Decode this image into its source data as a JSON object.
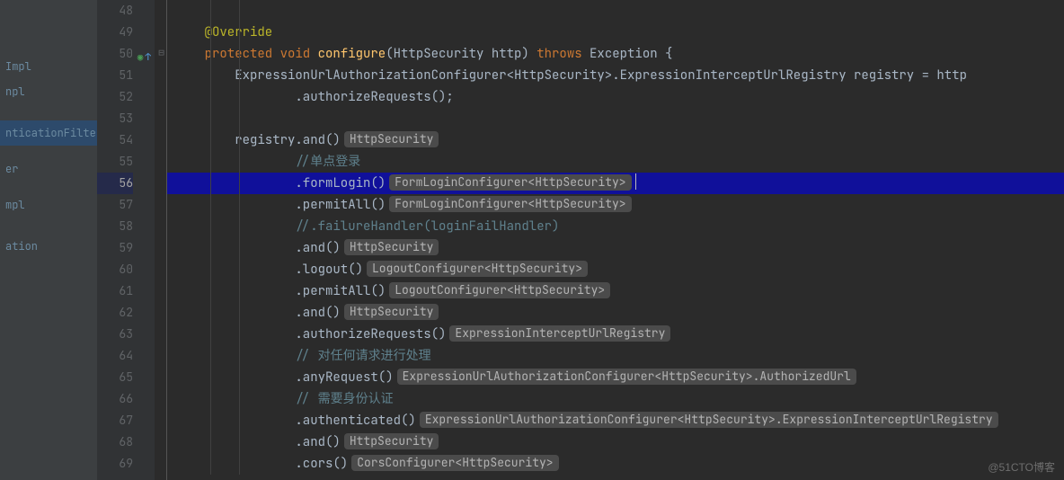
{
  "sidebar": {
    "items": [
      {
        "label": "Impl"
      },
      {
        "label": "npl"
      },
      {
        "label": ""
      },
      {
        "label": ""
      },
      {
        "label": ""
      },
      {
        "label": "nticationFilter"
      },
      {
        "label": ""
      },
      {
        "label": ""
      },
      {
        "label": "er"
      },
      {
        "label": ""
      },
      {
        "label": ""
      },
      {
        "label": "mpl"
      },
      {
        "label": ""
      },
      {
        "label": ""
      },
      {
        "label": ""
      },
      {
        "label": "ation"
      }
    ]
  },
  "gutter": {
    "start": 48,
    "end": 69,
    "highlight": 56,
    "override_line": 50
  },
  "code": {
    "lines": [
      {
        "n": 48,
        "segs": []
      },
      {
        "n": 49,
        "segs": [
          {
            "t": "    ",
            "c": ""
          },
          {
            "t": "@Override",
            "c": "kw-ann"
          }
        ]
      },
      {
        "n": 50,
        "segs": [
          {
            "t": "    ",
            "c": ""
          },
          {
            "t": "protected void ",
            "c": "kw"
          },
          {
            "t": "configure",
            "c": "fn"
          },
          {
            "t": "(HttpSecurity http) ",
            "c": ""
          },
          {
            "t": "throws ",
            "c": "kw"
          },
          {
            "t": "Exception {",
            "c": ""
          }
        ]
      },
      {
        "n": 51,
        "segs": [
          {
            "t": "        ExpressionUrlAuthorizationConfigurer<HttpSecurity>.ExpressionInterceptUrlRegistry registry = http",
            "c": ""
          }
        ]
      },
      {
        "n": 52,
        "segs": [
          {
            "t": "                .authorizeRequests();",
            "c": ""
          }
        ]
      },
      {
        "n": 53,
        "segs": []
      },
      {
        "n": 54,
        "segs": [
          {
            "t": "        registry.and()",
            "c": ""
          },
          {
            "hint": "HttpSecurity"
          }
        ]
      },
      {
        "n": 55,
        "segs": [
          {
            "t": "                ",
            "c": ""
          },
          {
            "t": "//单点登录",
            "c": "cmt-cn"
          }
        ]
      },
      {
        "n": 56,
        "hl": true,
        "segs": [
          {
            "t": "                .formLogin()",
            "c": ""
          },
          {
            "hint": "FormLoginConfigurer<HttpSecurity>"
          },
          {
            "caret": true
          }
        ]
      },
      {
        "n": 57,
        "segs": [
          {
            "t": "                .permitAll()",
            "c": ""
          },
          {
            "hint": "FormLoginConfigurer<HttpSecurity>"
          }
        ]
      },
      {
        "n": 58,
        "segs": [
          {
            "t": "                ",
            "c": ""
          },
          {
            "t": "//.failureHandler(loginFailHandler)",
            "c": "cmt-cn"
          }
        ]
      },
      {
        "n": 59,
        "segs": [
          {
            "t": "                .and()",
            "c": ""
          },
          {
            "hint": "HttpSecurity"
          }
        ]
      },
      {
        "n": 60,
        "segs": [
          {
            "t": "                .logout()",
            "c": ""
          },
          {
            "hint": "LogoutConfigurer<HttpSecurity>"
          }
        ]
      },
      {
        "n": 61,
        "segs": [
          {
            "t": "                .permitAll()",
            "c": ""
          },
          {
            "hint": "LogoutConfigurer<HttpSecurity>"
          }
        ]
      },
      {
        "n": 62,
        "segs": [
          {
            "t": "                .and()",
            "c": ""
          },
          {
            "hint": "HttpSecurity"
          }
        ]
      },
      {
        "n": 63,
        "segs": [
          {
            "t": "                .authorizeRequests()",
            "c": ""
          },
          {
            "hint": "ExpressionInterceptUrlRegistry"
          }
        ]
      },
      {
        "n": 64,
        "segs": [
          {
            "t": "                ",
            "c": ""
          },
          {
            "t": "// 对任何请求进行处理",
            "c": "cmt-cn"
          }
        ]
      },
      {
        "n": 65,
        "segs": [
          {
            "t": "                .anyRequest()",
            "c": ""
          },
          {
            "hint": "ExpressionUrlAuthorizationConfigurer<HttpSecurity>.AuthorizedUrl"
          }
        ]
      },
      {
        "n": 66,
        "segs": [
          {
            "t": "                ",
            "c": ""
          },
          {
            "t": "// 需要身份认证",
            "c": "cmt-cn"
          }
        ]
      },
      {
        "n": 67,
        "segs": [
          {
            "t": "                .authenticated()",
            "c": ""
          },
          {
            "hint": "ExpressionUrlAuthorizationConfigurer<HttpSecurity>.ExpressionInterceptUrlRegistry"
          }
        ]
      },
      {
        "n": 68,
        "segs": [
          {
            "t": "                .and()",
            "c": ""
          },
          {
            "hint": "HttpSecurity"
          }
        ]
      },
      {
        "n": 69,
        "segs": [
          {
            "t": "                .cors()",
            "c": ""
          },
          {
            "hint": "CorsConfigurer<HttpSecurity>"
          }
        ]
      }
    ]
  },
  "watermark": "@51CTO博客"
}
